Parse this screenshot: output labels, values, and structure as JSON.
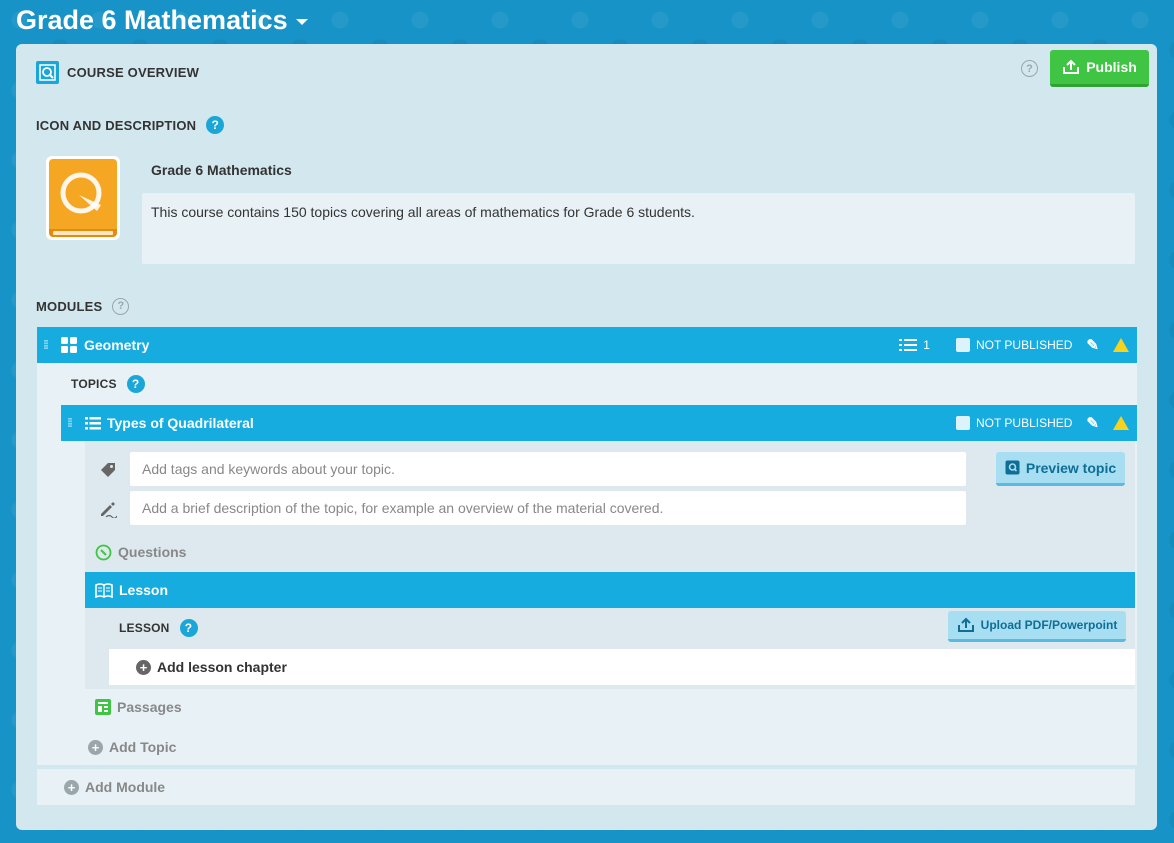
{
  "app": {
    "title": "Grade 6 Mathematics"
  },
  "overview": {
    "label": "COURSE OVERVIEW",
    "help": "?",
    "publish_label": "Publish"
  },
  "icon_description": {
    "label": "ICON AND DESCRIPTION",
    "help": "?",
    "course_name": "Grade 6 Mathematics",
    "description": "This course contains 150 topics covering all areas of mathematics for Grade 6 students."
  },
  "modules": {
    "label": "MODULES",
    "help": "?",
    "items": [
      {
        "name": "Geometry",
        "topic_count": "1",
        "status": "NOT PUBLISHED",
        "topics_label": "TOPICS",
        "topics_help": "?",
        "topics": [
          {
            "name": "Types of Quadrilateral",
            "status": "NOT PUBLISHED",
            "tags_placeholder": "Add tags and keywords about your topic.",
            "desc_placeholder": "Add a brief description of the topic, for example an overview of the material covered.",
            "preview_label": "Preview topic",
            "questions_label": "Questions",
            "lesson_label": "Lesson",
            "lesson_section_label": "LESSON",
            "lesson_help": "?",
            "upload_label": "Upload PDF/Powerpoint",
            "add_chapter_label": "Add lesson chapter",
            "passages_label": "Passages"
          }
        ],
        "add_topic_label": "Add Topic"
      }
    ],
    "add_module_label": "Add Module"
  },
  "colors": {
    "background": "#1793c7",
    "panel": "#d3e7ef",
    "accent": "#16ace0",
    "publish": "#3fc443",
    "course_icon": "#f5a623",
    "warning": "#f7d31b"
  },
  "icons": {
    "overview": "magnifier-app-icon",
    "module": "grid-icon",
    "topic": "list-icon",
    "count": "list-icon",
    "status": "publish-status-icon",
    "edit": "pencil-icon",
    "warning": "warning-icon",
    "tag": "tag-icon",
    "description": "pen-writing-icon",
    "questions": "question-magnifier-icon",
    "lesson": "open-book-icon",
    "passages": "document-icon",
    "add": "plus-circle-icon"
  }
}
